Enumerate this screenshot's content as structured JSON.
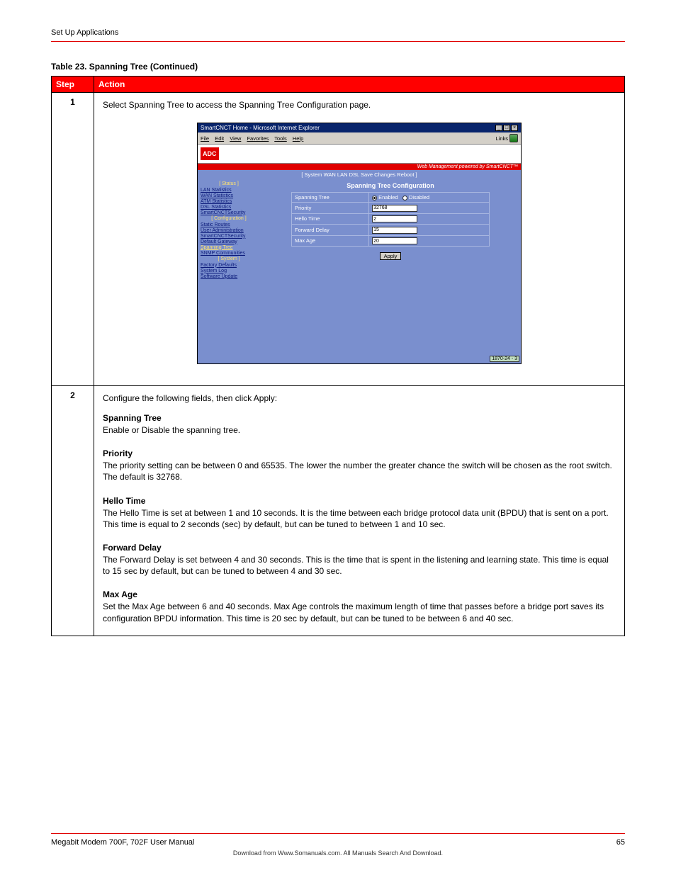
{
  "header": {
    "title": "Set Up Applications"
  },
  "tableCaption": "Table 23. Spanning Tree (Continued)",
  "columns": {
    "step": "Step",
    "action": "Action"
  },
  "row1": {
    "stepNo": "1",
    "lead": "Select Spanning Tree to access the Spanning Tree Configuration page."
  },
  "screenshot": {
    "windowTitle": "SmartCNCT Home - Microsoft Internet Explorer",
    "menus": [
      "File",
      "Edit",
      "View",
      "Favorites",
      "Tools",
      "Help"
    ],
    "linksLabel": "Links",
    "logoText": "ADC",
    "tagline": "Web Management powered by SmartCNCT™",
    "topnav": "[ System  WAN  LAN  DSL  Save Changes  Reboot ]",
    "sidebar": {
      "statusHeader": "[ Status ]",
      "statusLinks": [
        "LAN Statistics",
        "WAN Statistics",
        "ATM Statistics",
        "DSL Statistics",
        "SmartCNCTSecurity"
      ],
      "configHeader": "[ Configuration ]",
      "configLinks": [
        "Static Routes",
        "User Administration",
        "SmartCNCTSecurity",
        "Default Gateway",
        "Spanning Tree",
        "SNMP Communities"
      ],
      "systemHeader": "[ System ]",
      "systemLinks": [
        "Factory Defaults",
        "System Log",
        "Software Update"
      ]
    },
    "contentTitle": "Spanning Tree Configuration",
    "form": {
      "rows": [
        {
          "label": "Spanning Tree",
          "type": "radio",
          "enabled": "Enabled",
          "disabled": "Disabled"
        },
        {
          "label": "Priority",
          "type": "text",
          "value": "32768"
        },
        {
          "label": "Hello Time",
          "type": "text",
          "value": "2"
        },
        {
          "label": "Forward Delay",
          "type": "text",
          "value": "15"
        },
        {
          "label": "Max Age",
          "type": "text",
          "value": "20"
        }
      ],
      "applyLabel": "Apply"
    },
    "badge": "1870-24 - 3"
  },
  "row2": {
    "stepNo": "2",
    "lead": "Configure the following fields, then click Apply:",
    "fields": [
      {
        "name": "Spanning Tree",
        "desc": "Enable or Disable the spanning tree."
      },
      {
        "name": "Priority",
        "desc": "The priority setting can be between 0 and 65535. The lower the number the greater chance the switch will be chosen as the root switch. The default is 32768."
      },
      {
        "name": "Hello Time",
        "desc": "The Hello Time is set at between 1 and 10 seconds. It is the time between each bridge protocol data unit (BPDU) that is sent on a port. This time is equal to 2 seconds (sec) by default, but can be tuned to between 1 and 10 sec."
      },
      {
        "name": "Forward Delay",
        "desc": "The Forward Delay is set between 4 and 30 seconds. This is the time that is spent in the listening and learning state. This time is equal to 15 sec by default, but can be tuned to between 4 and 30 sec."
      },
      {
        "name": "Max Age",
        "desc": "Set the Max Age between 6 and 40 seconds. Max Age controls the maximum length of time that passes before a bridge port saves its configuration BPDU information. This time is 20 sec by default, but can be tuned to be between 6 and 40 sec."
      }
    ]
  },
  "footer": {
    "left": "Megabit Modem 700F, 702F User Manual",
    "right": "65",
    "legal": "Download from Www.Somanuals.com. All Manuals Search And Download."
  }
}
